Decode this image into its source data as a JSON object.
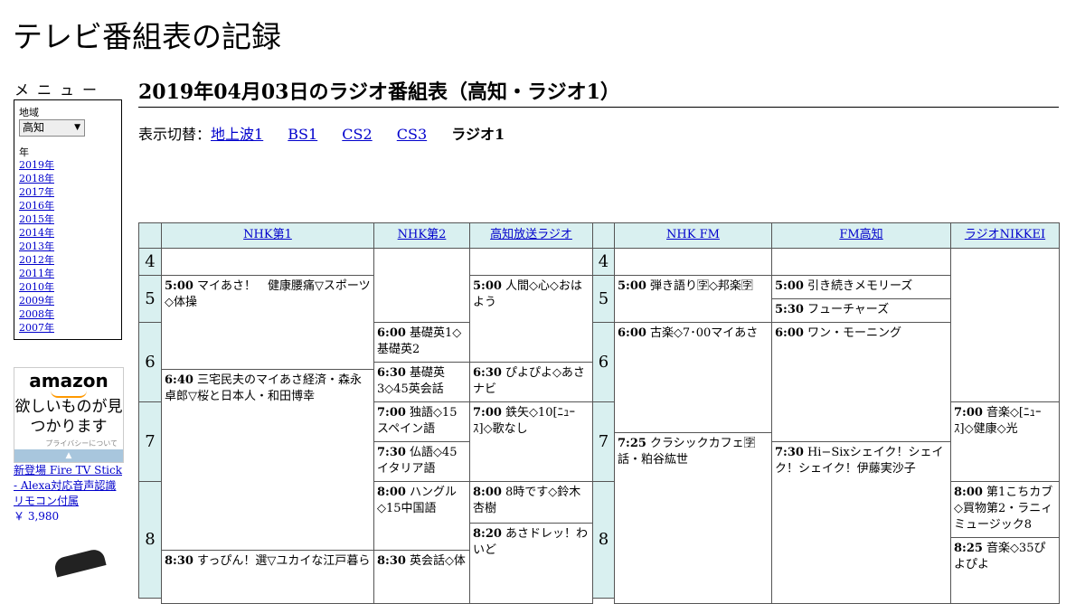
{
  "site_title": "テレビ番組表の記録",
  "menu": {
    "label": "メニュー",
    "region_label": "地域",
    "region_value": "高知",
    "year_label": "年",
    "years": [
      "2019年",
      "2018年",
      "2017年",
      "2016年",
      "2015年",
      "2014年",
      "2013年",
      "2012年",
      "2011年",
      "2010年",
      "2009年",
      "2008年",
      "2007年"
    ]
  },
  "ad": {
    "logo": "amazon",
    "text": "欲しいものが見つかります",
    "privacy": "プライバシーについて",
    "link_text": "新登場 Fire TV Stick - Alexa対応音声認識リモコン付属",
    "price": "￥ 3,980"
  },
  "page_heading": "2019年04月03日のラジオ番組表（高知・ラジオ1）",
  "switch": {
    "label": "表示切替：",
    "links": [
      "地上波1",
      "BS1",
      "CS2",
      "CS3"
    ],
    "current": "ラジオ1"
  },
  "stations": [
    "NHK第1",
    "NHK第2",
    "高知放送ラジオ",
    "NHK FM",
    "FM高知",
    "ラジオNIKKEI"
  ],
  "hours": [
    "4",
    "5",
    "6",
    "7",
    "8"
  ],
  "programs": {
    "nhk1": [
      {
        "time": "5:00",
        "title": "マイあさ！　健康腰痛▽スポーツ◇体操"
      },
      {
        "time": "6:40",
        "title": "三宅民夫のマイあさ経済・森永卓郎▽桜と日本人・和田博幸"
      },
      {
        "time": "8:30",
        "title": "すっぴん！選▽ユカイな江戸暮ら"
      }
    ],
    "nhk2": [
      {
        "time": "6:00",
        "title": "基礎英1◇基礎英2"
      },
      {
        "time": "6:30",
        "title": "基礎英3◇45英会話"
      },
      {
        "time": "7:00",
        "title": "独語◇15スペイン語"
      },
      {
        "time": "7:30",
        "title": "仏語◇45イタリア語"
      },
      {
        "time": "8:00",
        "title": "ハングル◇15中国語"
      },
      {
        "time": "8:30",
        "title": "英会話◇体"
      }
    ],
    "rkc": [
      {
        "time": "5:00",
        "title": "人間◇心◇おはよう"
      },
      {
        "time": "6:30",
        "title": "ぴよぴよ◇あさナビ"
      },
      {
        "time": "7:00",
        "title": "鉄矢◇10[ﾆｭｰｽ]◇歌なし"
      },
      {
        "time": "8:00",
        "title": "8時です◇鈴木杏樹"
      },
      {
        "time": "8:20",
        "title": "あさドレッ！わいど"
      }
    ],
    "nhkfm": [
      {
        "time": "5:00",
        "title": "弾き語り🈑◇邦楽🈑"
      },
      {
        "time": "6:00",
        "title": "古楽◇7･00マイあさ"
      },
      {
        "time": "7:25",
        "title": "クラシックカフェ🈑話・粕谷紘世"
      }
    ],
    "fmkochi": [
      {
        "time": "5:00",
        "title": "引き続きメモリーズ"
      },
      {
        "time": "5:30",
        "title": "フューチャーズ"
      },
      {
        "time": "6:00",
        "title": "ワン・モーニング"
      },
      {
        "time": "7:30",
        "title": "Hi−Sixシェイク！シェイク！シェイク！伊藤実沙子"
      }
    ],
    "nikkei": [
      {
        "time": "7:00",
        "title": "音楽◇[ﾆｭｰｽ]◇健康◇光"
      },
      {
        "time": "8:00",
        "title": "第1こちカブ◇買物第2・ラニィミュージック8"
      },
      {
        "time": "8:25",
        "title": "音楽◇35ぴよぴよ"
      }
    ]
  }
}
